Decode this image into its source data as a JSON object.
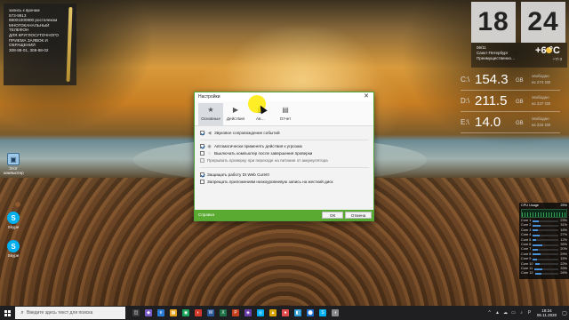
{
  "sticky": {
    "lines": [
      "запись к врачам",
      "573-9913",
      "88001000800 ростелеком",
      "МНОГОКАНАЛЬНЫЙ",
      "ТЕЛЕФОН",
      "ДЛЯ КРУГЛОСУТОЧНОГО",
      "ПРИЕМА ЗАЯВОК И",
      "ОБРАЩЕНИЙ",
      "308-88-01, 308-88-02"
    ]
  },
  "desktop_icons": [
    {
      "label": "Этот компьютер",
      "glyph": "▣"
    },
    {
      "label": "Skype",
      "glyph": "S"
    },
    {
      "label": "Skype",
      "glyph": "S"
    }
  ],
  "clock": {
    "hours": "18",
    "minutes": "24"
  },
  "weather": {
    "date": "06/11",
    "city": "Санкт-Петербург",
    "condition": "Преимущественно…",
    "temp": "+6 °C",
    "range": "+7/-3"
  },
  "drives": [
    {
      "letter": "C:\\",
      "size": "154.3",
      "unit": "GB",
      "info1": "свободно",
      "info2": "из 274 GB"
    },
    {
      "letter": "D:\\",
      "size": "211.5",
      "unit": "GB",
      "info1": "свободно",
      "info2": "из 237 GB"
    },
    {
      "letter": "E:\\",
      "size": "14.0",
      "unit": "GB",
      "info1": "свободно",
      "info2": "из 234 GB"
    }
  ],
  "cpu": {
    "title": "CPU Usage",
    "percent": "25%",
    "rows": [
      {
        "label": "Core 1",
        "value": "23%",
        "level": 0.23
      },
      {
        "label": "Core 2",
        "value": "31%",
        "level": 0.31
      },
      {
        "label": "Core 3",
        "value": "18%",
        "level": 0.18
      },
      {
        "label": "Core 4",
        "value": "27%",
        "level": 0.27
      },
      {
        "label": "Core 5",
        "value": "12%",
        "level": 0.12
      },
      {
        "label": "Core 6",
        "value": "35%",
        "level": 0.35
      },
      {
        "label": "Core 7",
        "value": "20%",
        "level": 0.2
      },
      {
        "label": "Core 8",
        "value": "29%",
        "level": 0.29
      },
      {
        "label": "Core 9",
        "value": "15%",
        "level": 0.15
      },
      {
        "label": "Core 10",
        "value": "22%",
        "level": 0.22
      },
      {
        "label": "Core 11",
        "value": "33%",
        "level": 0.33
      },
      {
        "label": "Core 12",
        "value": "26%",
        "level": 0.26
      }
    ]
  },
  "dialog": {
    "title": "Настройки",
    "close_glyph": "✕",
    "tabs": [
      {
        "label": "Основные",
        "glyph": "★"
      },
      {
        "label": "Действия",
        "glyph": "▶"
      },
      {
        "label": "Ав…",
        "glyph": "▦"
      },
      {
        "label": "Отчет",
        "glyph": "▤"
      }
    ],
    "options": {
      "sound": "Звуковое сопровождение событий",
      "auto_apply": "Автоматически применять действия к угрозам",
      "shutdown": "Выключать компьютер после завершения проверки",
      "battery": "Прерывать проверку при переходе на питание от аккумулятора",
      "protect": "Защищать работу Dr.Web CureIt!",
      "block_disk": "Запрещать приложениям низкоуровневую запись на жесткий диск"
    },
    "help": "Справка",
    "ok": "ОК",
    "cancel": "Отмена"
  },
  "taskbar": {
    "search_placeholder": "Введите здесь текст для поиска",
    "apps": [
      {
        "glyph": "◫",
        "color": "#3b3b3f"
      },
      {
        "glyph": "◆",
        "color": "#7a5cc7"
      },
      {
        "glyph": "e",
        "color": "#2b7bd3"
      },
      {
        "glyph": "▦",
        "color": "#e6a11a"
      },
      {
        "glyph": "◉",
        "color": "#1ba35a"
      },
      {
        "glyph": "◐",
        "color": "#d33a2c"
      },
      {
        "glyph": "W",
        "color": "#2b579a"
      },
      {
        "glyph": "X",
        "color": "#1e7145"
      },
      {
        "glyph": "P",
        "color": "#c43e1c"
      },
      {
        "glyph": "◈",
        "color": "#6a3da8"
      },
      {
        "glyph": "◎",
        "color": "#00aff0"
      },
      {
        "glyph": "▲",
        "color": "#d9a400"
      },
      {
        "glyph": "●",
        "color": "#e04c4c"
      },
      {
        "glyph": "◧",
        "color": "#2d9bd6"
      },
      {
        "glyph": "⬤",
        "color": "#1f6fd1"
      },
      {
        "glyph": "S",
        "color": "#00aff0"
      },
      {
        "glyph": "◑",
        "color": "#8c8c8c"
      }
    ],
    "tray_icons": [
      "^",
      "▲",
      "☁",
      "▭",
      "♪",
      "Р"
    ],
    "time": "18:24",
    "date": "06.11.2020",
    "notif_glyph": "▢"
  }
}
